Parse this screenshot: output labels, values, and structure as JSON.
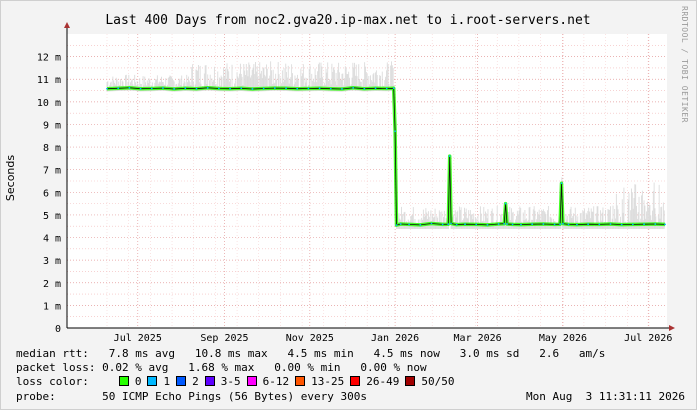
{
  "chart_data": {
    "type": "area",
    "title": "Last 400 Days from noc2.gva20.ip-max.net to i.root-servers.net",
    "ylabel": "Seconds",
    "ylim": [
      0,
      0.013
    ],
    "yticks": [
      {
        "v": 0,
        "label": "0"
      },
      {
        "v": 0.001,
        "label": "1 m"
      },
      {
        "v": 0.002,
        "label": "2 m"
      },
      {
        "v": 0.003,
        "label": "3 m"
      },
      {
        "v": 0.004,
        "label": "4 m"
      },
      {
        "v": 0.005,
        "label": "5 m"
      },
      {
        "v": 0.006,
        "label": "6 m"
      },
      {
        "v": 0.007,
        "label": "7 m"
      },
      {
        "v": 0.008,
        "label": "8 m"
      },
      {
        "v": 0.009,
        "label": "9 m"
      },
      {
        "v": 0.01,
        "label": "10 m"
      },
      {
        "v": 0.011,
        "label": "11 m"
      },
      {
        "v": 0.012,
        "label": "12 m"
      }
    ],
    "xticks": [
      "Jul 2025",
      "Sep 2025",
      "Nov 2025",
      "Jan 2026",
      "Mar 2026",
      "May 2026",
      "Jul 2026"
    ],
    "series": [
      {
        "name": "median rtt",
        "x": [
          0,
          8,
          16,
          24,
          32,
          40,
          48,
          56,
          64,
          72,
          80,
          88,
          96,
          104,
          112,
          120,
          128,
          136,
          144,
          152,
          160,
          168,
          176,
          184,
          192,
          200,
          205,
          206,
          207,
          210,
          216,
          224,
          232,
          240,
          244,
          245,
          246,
          250,
          256,
          264,
          272,
          280,
          284,
          285,
          286,
          290,
          296,
          304,
          312,
          320,
          324,
          325,
          326,
          330,
          336,
          344,
          352,
          360,
          368,
          376,
          384,
          392,
          399
        ],
        "y": [
          0.01058,
          0.0106,
          0.01062,
          0.01058,
          0.01059,
          0.01061,
          0.01057,
          0.0106,
          0.01058,
          0.01062,
          0.01059,
          0.01058,
          0.0106,
          0.01057,
          0.01059,
          0.01061,
          0.0106,
          0.01058,
          0.01059,
          0.0106,
          0.01058,
          0.01057,
          0.01062,
          0.01058,
          0.0106,
          0.01059,
          0.0106,
          0.0087,
          0.00455,
          0.0046,
          0.00458,
          0.00456,
          0.00462,
          0.00458,
          0.00459,
          0.0076,
          0.00462,
          0.00457,
          0.00459,
          0.00458,
          0.00456,
          0.0046,
          0.00461,
          0.0055,
          0.0046,
          0.00458,
          0.00457,
          0.00459,
          0.0046,
          0.00458,
          0.00459,
          0.0064,
          0.00461,
          0.00458,
          0.00457,
          0.00459,
          0.00458,
          0.0046,
          0.00457,
          0.00458,
          0.00459,
          0.0046,
          0.00458
        ]
      }
    ],
    "grid": true
  },
  "legend": {
    "median": {
      "label": "median rtt:",
      "text": "   7.8 ms avg   10.8 ms max   4.5 ms min   4.5 ms now   3.0 ms sd   2.6   am/s"
    },
    "loss": {
      "label": "packet loss:",
      "text": " 0.02 % avg   1.68 % max   0.00 % min   0.00 % now"
    },
    "color": {
      "label": "loss color:",
      "items": [
        {
          "label": "0",
          "color": "#26ff00"
        },
        {
          "label": "1",
          "color": "#00b8ff"
        },
        {
          "label": "2",
          "color": "#0059ff"
        },
        {
          "label": "3-5",
          "color": "#5e00ff"
        },
        {
          "label": "6-12",
          "color": "#ff00ff"
        },
        {
          "label": "13-25",
          "color": "#ff5500"
        },
        {
          "label": "26-49",
          "color": "#ff0000"
        },
        {
          "label": "50/50",
          "color": "#a10000"
        }
      ]
    },
    "probe": {
      "label": "probe:",
      "text": "       50 ICMP Echo Pings (56 Bytes) every 300s"
    }
  },
  "timestamp": "Mon Aug  3 11:31:11 2026",
  "credit": "RRDTOOL / TOBI OETIKER"
}
